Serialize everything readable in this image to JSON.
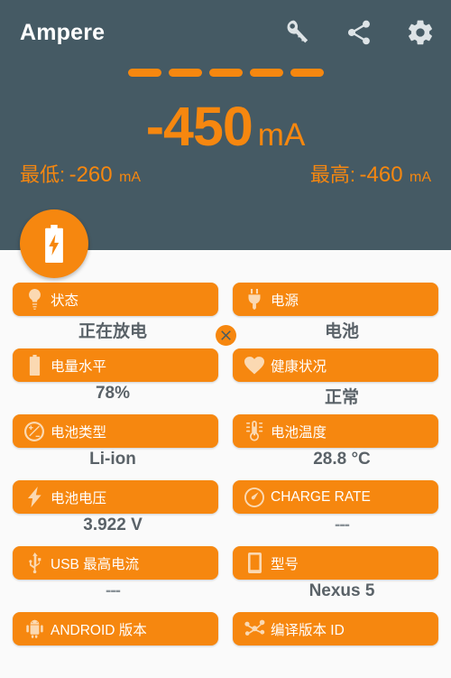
{
  "header": {
    "app_title": "Ampere",
    "actions": [
      {
        "name": "key-icon",
        "label": "Key"
      },
      {
        "name": "share-icon",
        "label": "Share"
      },
      {
        "name": "gear-icon",
        "label": "Settings"
      }
    ],
    "dash_count": 5,
    "reading": {
      "value": "-450",
      "unit": "mA"
    },
    "min": {
      "label": "最低:",
      "value": "-260",
      "unit": "mA"
    },
    "max": {
      "label": "最高:",
      "value": "-460",
      "unit": "mA"
    },
    "reset_button": "×",
    "fab_icon": "battery-bolt-icon"
  },
  "colors": {
    "header_bg": "#455a64",
    "accent": "#f6870f",
    "page_bg": "#fafafa",
    "value_text": "#5a6268",
    "chip_text": "#ffffff",
    "chip_icon": "#fbd9b2"
  },
  "cards": [
    {
      "icon": "lightbulb-icon",
      "label": "状态",
      "value": "正在放电"
    },
    {
      "icon": "power-plug-icon",
      "label": "电源",
      "value": "电池"
    },
    {
      "icon": "battery-icon",
      "label": "电量水平",
      "value": "78%"
    },
    {
      "icon": "heart-icon",
      "label": "健康状况",
      "value": "正常"
    },
    {
      "icon": "polarity-icon",
      "label": "电池类型",
      "value": "Li-ion"
    },
    {
      "icon": "thermometer-icon",
      "label": "电池温度",
      "value": "28.8 °C"
    },
    {
      "icon": "bolt-icon",
      "label": "电池电压",
      "value": "3.922 V"
    },
    {
      "icon": "gauge-icon",
      "label": "CHARGE RATE",
      "value": "---"
    },
    {
      "icon": "usb-icon",
      "label": "USB 最高电流",
      "value": "---"
    },
    {
      "icon": "phone-icon",
      "label": "型号",
      "value": "Nexus 5"
    },
    {
      "icon": "android-icon",
      "label": "ANDROID 版本",
      "value": ""
    },
    {
      "icon": "molecule-icon",
      "label": "编译版本 ID",
      "value": ""
    }
  ]
}
